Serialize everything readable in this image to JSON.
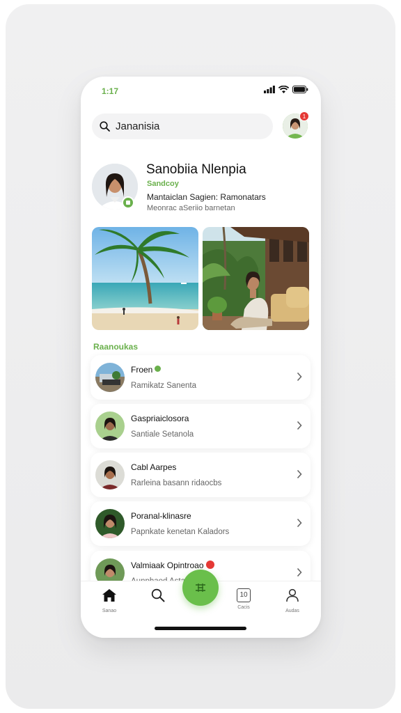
{
  "status": {
    "time": "1:17"
  },
  "search": {
    "query": "Jananisia"
  },
  "notifications": {
    "count": "1"
  },
  "profile": {
    "name": "Sanobiia Nlenpia",
    "role": "Sandcoy",
    "desc1": "Mantaiclan Sagien: Ramonatars",
    "desc2": "Meonrac aSeriio barnetan"
  },
  "section": {
    "title": "Raanoukas"
  },
  "contacts": [
    {
      "name": "Froen",
      "subtitle": "Ramikatz Sanenta",
      "indicator": "online"
    },
    {
      "name": "Gaspriaiclosora",
      "subtitle": "Santiale Setanola",
      "indicator": ""
    },
    {
      "name": "Cabl Aarpes",
      "subtitle": "Rarleina basann ridaocbs",
      "indicator": ""
    },
    {
      "name": "Poranal-klinasre",
      "subtitle": "Papnkate kenetan Kaladors",
      "indicator": ""
    },
    {
      "name": "Valmiaak Opintroao",
      "subtitle": "Aunphaod Astaran",
      "indicator": "unread"
    }
  ],
  "nav": {
    "home": "Sanao",
    "search": "",
    "calendar_icon_text": "10",
    "calendar": "Cacis",
    "profile": "Audas"
  },
  "colors": {
    "accent": "#6ab04c",
    "badge": "#e53935"
  }
}
